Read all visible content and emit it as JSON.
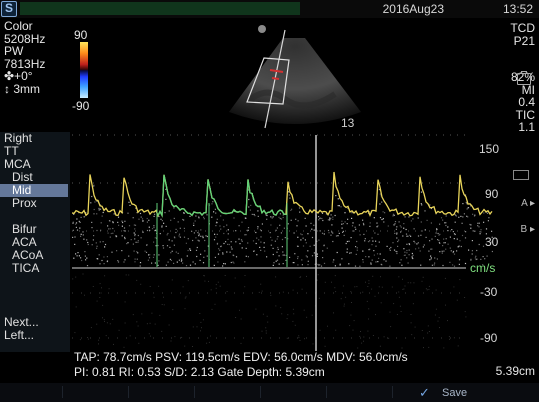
{
  "header": {
    "date": "2016Aug23",
    "time": "13:52"
  },
  "params": {
    "mode": "Color",
    "color_freq": "5208Hz",
    "pw_label": "PW",
    "pw_freq": "7813Hz",
    "angle": "✤+0°",
    "gate": "↕ 3mm"
  },
  "colorbar": {
    "top": "90",
    "bottom": "-90"
  },
  "sector": {
    "depth_index": "13"
  },
  "right_panel": {
    "preset": "TCD",
    "probe": "P21",
    "power": "82%",
    "mi_label": "MI",
    "mi_value": "0.4",
    "tic_label": "TIC",
    "tic_value": "1.1"
  },
  "side_menu": {
    "items": [
      "Right",
      "TT",
      "MCA",
      "Dist",
      "Mid",
      "Prox",
      "Bifur",
      "ACA",
      "ACoA",
      "TICA",
      "Next...",
      "Left..."
    ],
    "active": "Mid"
  },
  "spectral": {
    "scale": [
      "150",
      "90",
      "30",
      "-30",
      "-90"
    ],
    "unit": "cm/s",
    "envelope_color": "#e8d45a",
    "highlight_color": "#5fd17a"
  },
  "measurements": {
    "line1": "TAP: 78.7cm/s PSV: 119.5cm/s EDV: 56.0cm/s MDV: 56.0cm/s",
    "line2": "PI: 0.81 RI: 0.53 S/D: 2.13 Gate Depth: 5.39cm"
  },
  "depth_right": "5.39cm",
  "bottom": {
    "save_label": "Save"
  }
}
